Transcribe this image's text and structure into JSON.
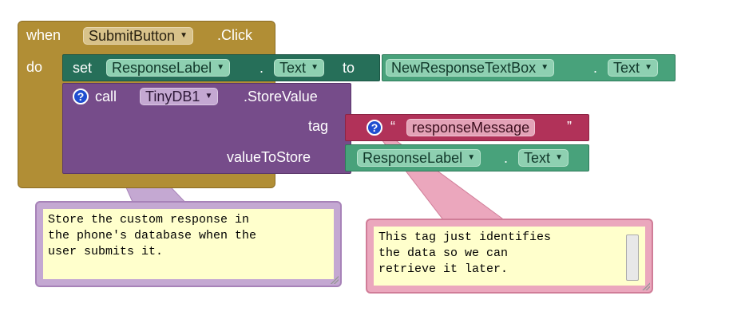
{
  "event": {
    "keyword_when": "when",
    "keyword_do": "do",
    "component": "SubmitButton",
    "event_name": ".Click"
  },
  "set_block": {
    "keyword_set": "set",
    "component": "ResponseLabel",
    "dot": ".",
    "property": "Text",
    "keyword_to": "to"
  },
  "getter1": {
    "component": "NewResponseTextBox",
    "dot": ".",
    "property": "Text"
  },
  "call_block": {
    "keyword_call": "call",
    "component": "TinyDB1",
    "method": ".StoreValue",
    "param_tag": "tag",
    "param_value": "valueToStore",
    "help": "?"
  },
  "text_block": {
    "open_quote": "“",
    "value": "responseMessage",
    "close_quote": "”",
    "help": "?"
  },
  "getter2": {
    "component": "ResponseLabel",
    "dot": ".",
    "property": "Text"
  },
  "comments": {
    "call_comment": "Store the custom response in\nthe phone's database when the\nuser submits it.",
    "tag_comment": "This tag just identifies\nthe data so we can\nretrieve it later."
  },
  "colors": {
    "event_block": "#b18e35",
    "set_block": "#266f59",
    "getter_block": "#48a27b",
    "call_block": "#764c8a",
    "text_block": "#b13259",
    "comment_background": "#ffffcc"
  }
}
